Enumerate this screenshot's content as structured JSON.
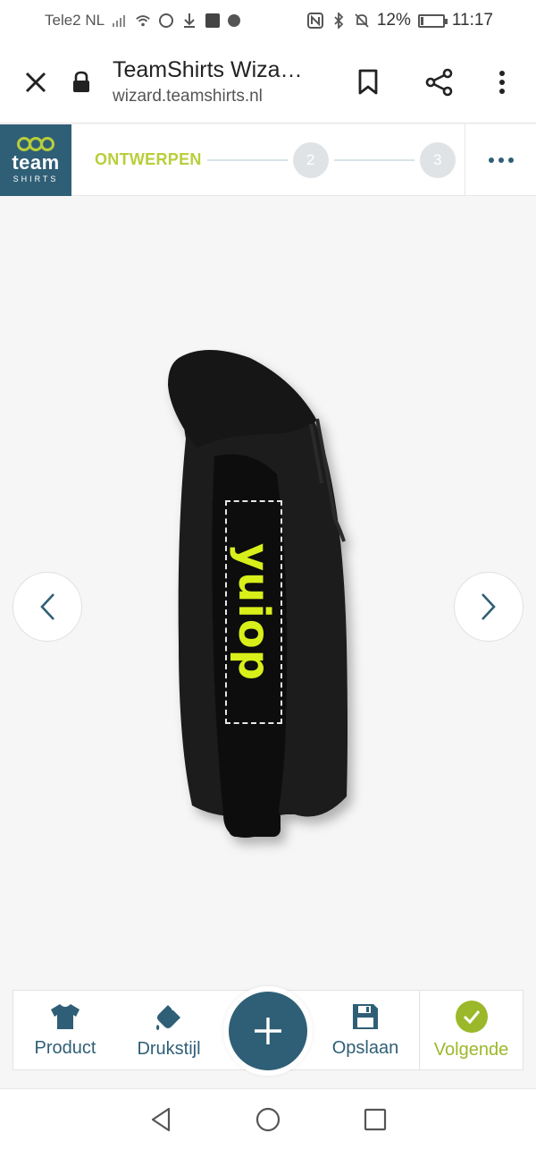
{
  "status_bar": {
    "carrier": "Tele2 NL",
    "battery": "12%",
    "battery_level": 0.12,
    "time": "11:17",
    "icons": [
      "signal-icon",
      "wifi-icon",
      "whatsapp-icon",
      "download-icon",
      "app-icon",
      "dot-icon",
      "nfc-icon",
      "bluetooth-icon",
      "mute-icon",
      "battery-icon"
    ]
  },
  "browser": {
    "title": "TeamShirts Wiza…",
    "host": "wizard.teamshirts.nl",
    "icons": [
      "close-icon",
      "lock-icon",
      "bookmark-icon",
      "share-icon",
      "more-vert-icon"
    ]
  },
  "header": {
    "logo_word": "team",
    "logo_sub": "SHIRTS",
    "step1_label": "ONTWERPEN",
    "step2_number": "2",
    "step3_number": "3",
    "more_icon": "more-horiz-icon"
  },
  "canvas": {
    "design_text": "yuiop",
    "prev_icon": "chevron-left-icon",
    "next_icon": "chevron-right-icon"
  },
  "toolbar": {
    "product_label": "Product",
    "drukstijl_label": "Drukstijl",
    "opslaan_label": "Opslaan",
    "volgende_label": "Volgende",
    "add_icon": "plus-icon"
  },
  "colors": {
    "brand_blue": "#2f5f76",
    "brand_green": "#b9ce3a",
    "design_yellow": "#d8ef1a"
  }
}
